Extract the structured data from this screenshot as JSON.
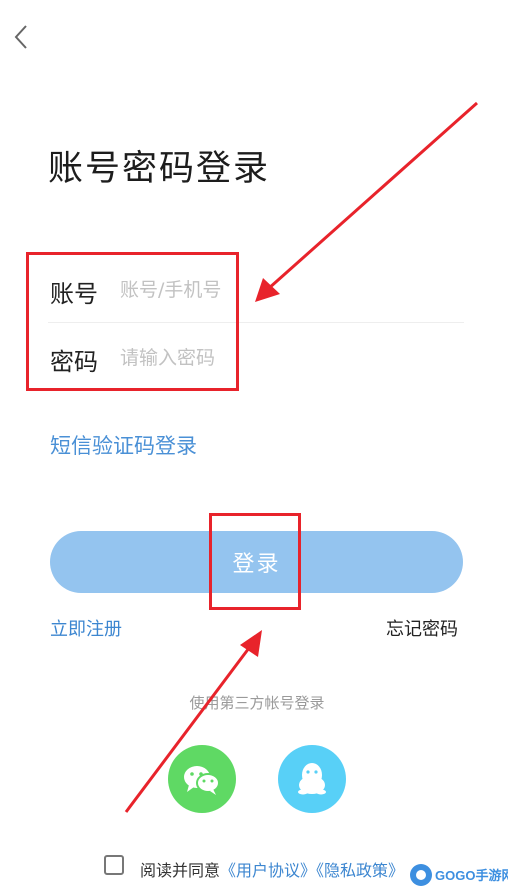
{
  "page": {
    "title": "账号密码登录"
  },
  "form": {
    "account_label": "账号",
    "account_placeholder": "账号/手机号",
    "password_label": "密码",
    "password_placeholder": "请输入密码"
  },
  "links": {
    "sms_login": "短信验证码登录",
    "register": "立即注册",
    "forgot_password": "忘记密码"
  },
  "login_button": {
    "label": "登录",
    "color": "#94c4ef"
  },
  "third_party": {
    "label": "使用第三方帐号登录",
    "providers": [
      {
        "name": "wechat",
        "icon": "wechat-icon",
        "color": "#5fd964"
      },
      {
        "name": "qq",
        "icon": "qq-icon",
        "color": "#58d0f7"
      }
    ]
  },
  "agreement": {
    "prefix": "阅读并同意",
    "user_agreement": "《用户协议》",
    "privacy_policy": "《隐私政策》"
  },
  "watermark": {
    "brand": "GOGO手游网"
  },
  "accent_color": "#e8232b"
}
